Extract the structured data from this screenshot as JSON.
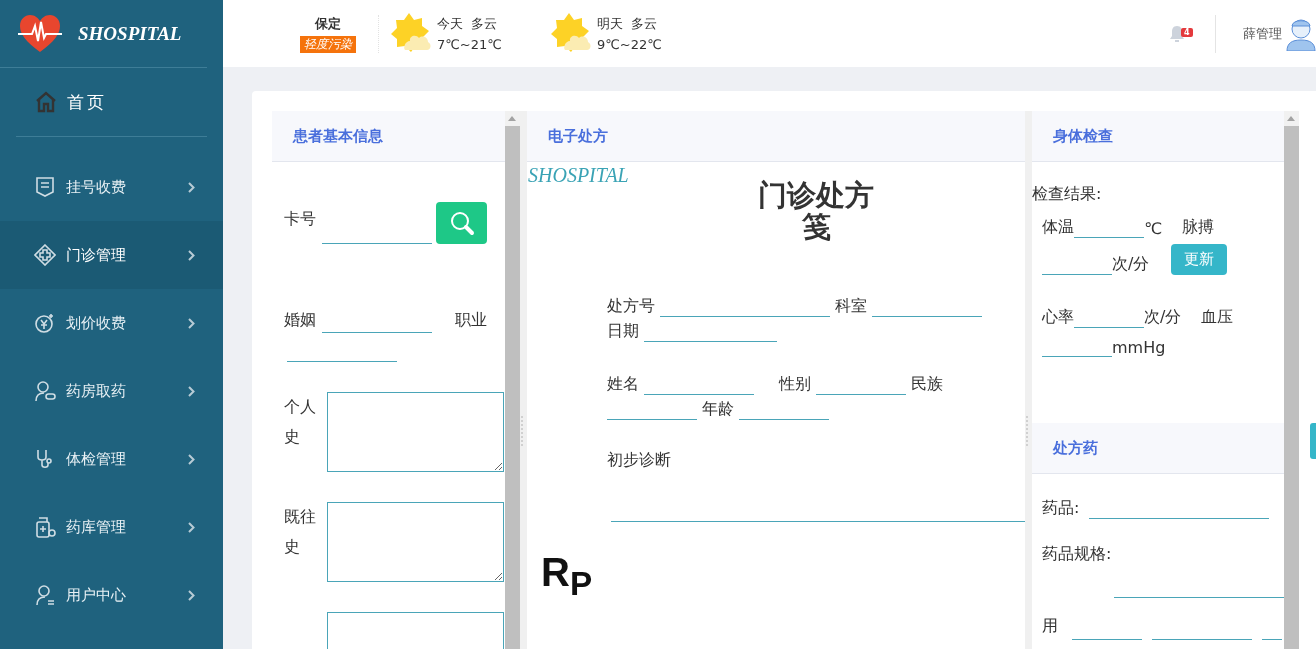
{
  "header": {
    "logo": "SHOSPITAL",
    "city": "保定",
    "air_quality": "轻度污染",
    "weather": [
      {
        "day": "今天",
        "condition": "多云",
        "temperature": "7℃~21℃"
      },
      {
        "day": "明天",
        "condition": "多云",
        "temperature": "9℃~22℃"
      }
    ],
    "notification_count": "4",
    "user": "薛管理"
  },
  "sidebar": {
    "home": "首页",
    "items": [
      {
        "label": "挂号收费",
        "selected": false
      },
      {
        "label": "门诊管理",
        "selected": true
      },
      {
        "label": "划价收费",
        "selected": false
      },
      {
        "label": "药房取药",
        "selected": false
      },
      {
        "label": "体检管理",
        "selected": false
      },
      {
        "label": "药库管理",
        "selected": false
      },
      {
        "label": "用户中心",
        "selected": false
      }
    ]
  },
  "patient_info": {
    "title": "患者基本信息",
    "card_label": "卡号",
    "marriage_label": "婚姻",
    "occupation_label": "职业",
    "histories": [
      "个人史",
      "既往史"
    ]
  },
  "prescription": {
    "title": "电子处方",
    "brand": "SHOSPITAL",
    "heading": "门诊处方笺",
    "number_label": "处方号",
    "department_label": "科室",
    "date_label": "日期",
    "name_label": "姓名",
    "gender_label": "性别",
    "ethnicity_label": "民族",
    "age_label": "年龄",
    "diagnosis_label": "初步诊断",
    "rp": "R$_{P}$"
  },
  "exam": {
    "title": "身体检查",
    "result_label": "检查结果:",
    "temperature_label": "体温",
    "temperature_unit": "℃",
    "pulse_label": "脉搏",
    "pulse_unit": "次/分",
    "update_button": "更新",
    "heart_rate_label": "心率",
    "heart_rate_unit": "次/分",
    "blood_pressure_label": "血压",
    "blood_pressure_unit": "mmHg"
  },
  "drugs": {
    "title": "处方药",
    "drug_label": "药品:",
    "spec_label": "药品规格:",
    "usage_label": "用"
  }
}
